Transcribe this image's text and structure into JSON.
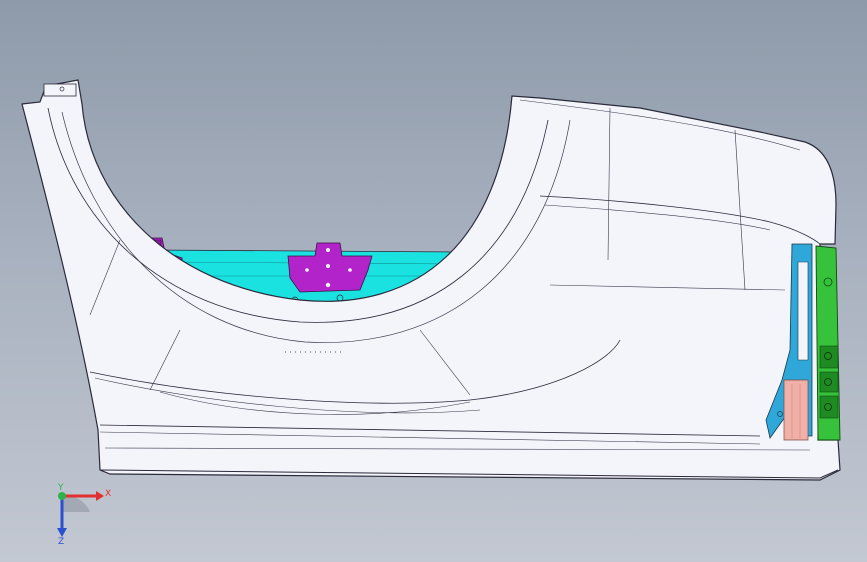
{
  "viewport": {
    "background_top": "#8e9aaa",
    "background_bottom": "#c3c8d2",
    "model": {
      "shell_color": "#f4f4fb",
      "edge_color": "#2a2a3a",
      "inner_cyan": "#19e2e0",
      "bracket_magenta": "#b224c9",
      "frame_green": "#36c23a",
      "pad_pink": "#f0b0a8",
      "side_blue": "#2fa7d8"
    }
  },
  "triad": {
    "x_label": "X",
    "y_label": "Y",
    "z_label": "Z",
    "x_color": "#e23030",
    "y_color": "#2fb24a",
    "z_color": "#2b4fd0"
  }
}
